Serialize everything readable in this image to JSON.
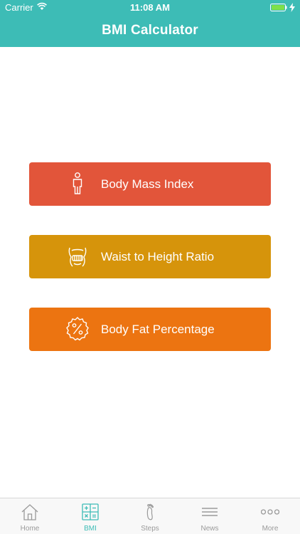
{
  "status_bar": {
    "carrier": "Carrier",
    "time": "11:08 AM"
  },
  "header": {
    "title": "BMI Calculator",
    "color": "#3dbcb6"
  },
  "menu": [
    {
      "label": "Body Mass Index",
      "icon": "person-icon",
      "color": "#e2553a"
    },
    {
      "label": "Waist to Height Ratio",
      "icon": "waist-icon",
      "color": "#d6940b"
    },
    {
      "label": "Body Fat Percentage",
      "icon": "percent-badge-icon",
      "color": "#ec7411"
    }
  ],
  "tabbar": {
    "active": "BMI",
    "tabs": [
      {
        "label": "Home",
        "icon": "home-icon"
      },
      {
        "label": "BMI",
        "icon": "calculator-icon"
      },
      {
        "label": "Steps",
        "icon": "footprint-icon"
      },
      {
        "label": "News",
        "icon": "lines-icon"
      },
      {
        "label": "More",
        "icon": "more-dots-icon"
      }
    ]
  }
}
